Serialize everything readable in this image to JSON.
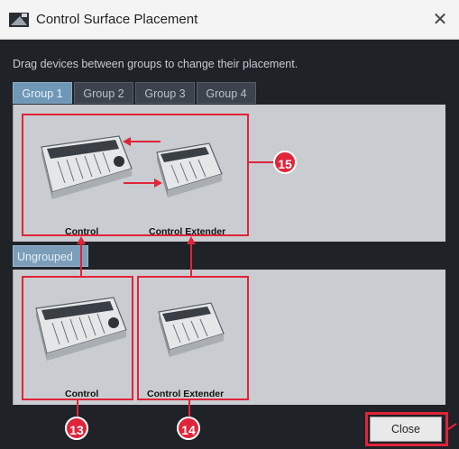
{
  "window": {
    "title": "Control Surface Placement",
    "close_glyph": "✕"
  },
  "instruction": "Drag devices between groups to change their placement.",
  "tabs": [
    {
      "label": "Group 1",
      "active": true
    },
    {
      "label": "Group 2",
      "active": false
    },
    {
      "label": "Group 3",
      "active": false
    },
    {
      "label": "Group 4",
      "active": false
    }
  ],
  "group_devices": [
    {
      "label": "Control"
    },
    {
      "label": "Control Extender"
    }
  ],
  "ungrouped_label": "Ungrouped",
  "ungrouped_devices": [
    {
      "label": "Control"
    },
    {
      "label": "Control Extender"
    }
  ],
  "annotations": {
    "badge_15": "15",
    "badge_13": "13",
    "badge_14": "14",
    "accent": "#e0243a"
  },
  "buttons": {
    "close_label": "Close"
  },
  "icons": [
    "app-icon",
    "close-icon",
    "arrow-left-icon",
    "arrow-right-icon"
  ]
}
